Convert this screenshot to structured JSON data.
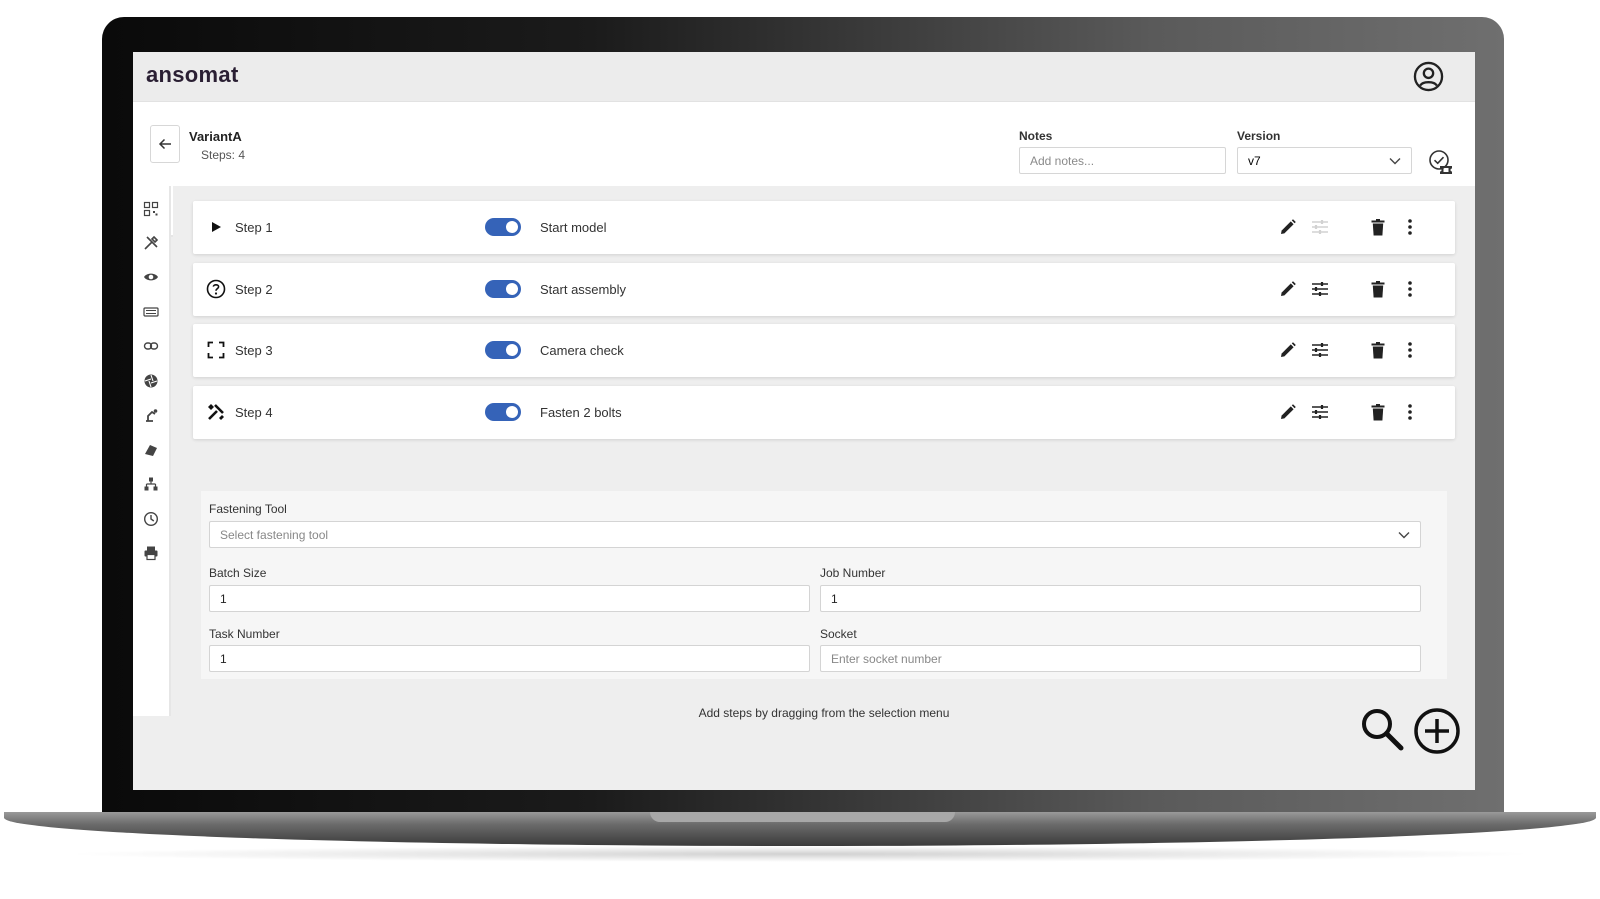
{
  "app": {
    "logo": "ansomat"
  },
  "header": {
    "variant_name": "VariantA",
    "steps_count": "Steps: 4",
    "notes_label": "Notes",
    "notes_placeholder": "Add notes...",
    "version_label": "Version",
    "version_value": "v7"
  },
  "sidebar": {
    "items": [
      "qr-code-icon",
      "tools-icon",
      "eye-icon",
      "keyboard-icon",
      "link-icon",
      "aperture-icon",
      "robot-arm-icon",
      "layers-icon",
      "hierarchy-icon",
      "clock-icon",
      "printer-icon"
    ]
  },
  "steps": [
    {
      "label": "Step 1",
      "description": "Start model",
      "enabled": true,
      "icon": "play-icon",
      "settings_disabled": true
    },
    {
      "label": "Step 2",
      "description": "Start assembly",
      "enabled": true,
      "icon": "help-circle-icon",
      "settings_disabled": false
    },
    {
      "label": "Step 3",
      "description": "Camera check",
      "enabled": true,
      "icon": "frame-corners-icon",
      "settings_disabled": false
    },
    {
      "label": "Step 4",
      "description": "Fasten 2 bolts",
      "enabled": true,
      "icon": "tools-icon",
      "settings_disabled": false
    }
  ],
  "step4_details": {
    "fastening_tool_label": "Fastening Tool",
    "fastening_tool_placeholder": "Select fastening tool",
    "batch_size_label": "Batch Size",
    "batch_size_value": "1",
    "job_number_label": "Job Number",
    "job_number_value": "1",
    "task_number_label": "Task Number",
    "task_number_value": "1",
    "socket_label": "Socket",
    "socket_placeholder": "Enter socket number"
  },
  "hint": "Add steps by dragging from the selection menu",
  "colors": {
    "toggle": "#3563b8",
    "logo": "#2a1f33"
  }
}
